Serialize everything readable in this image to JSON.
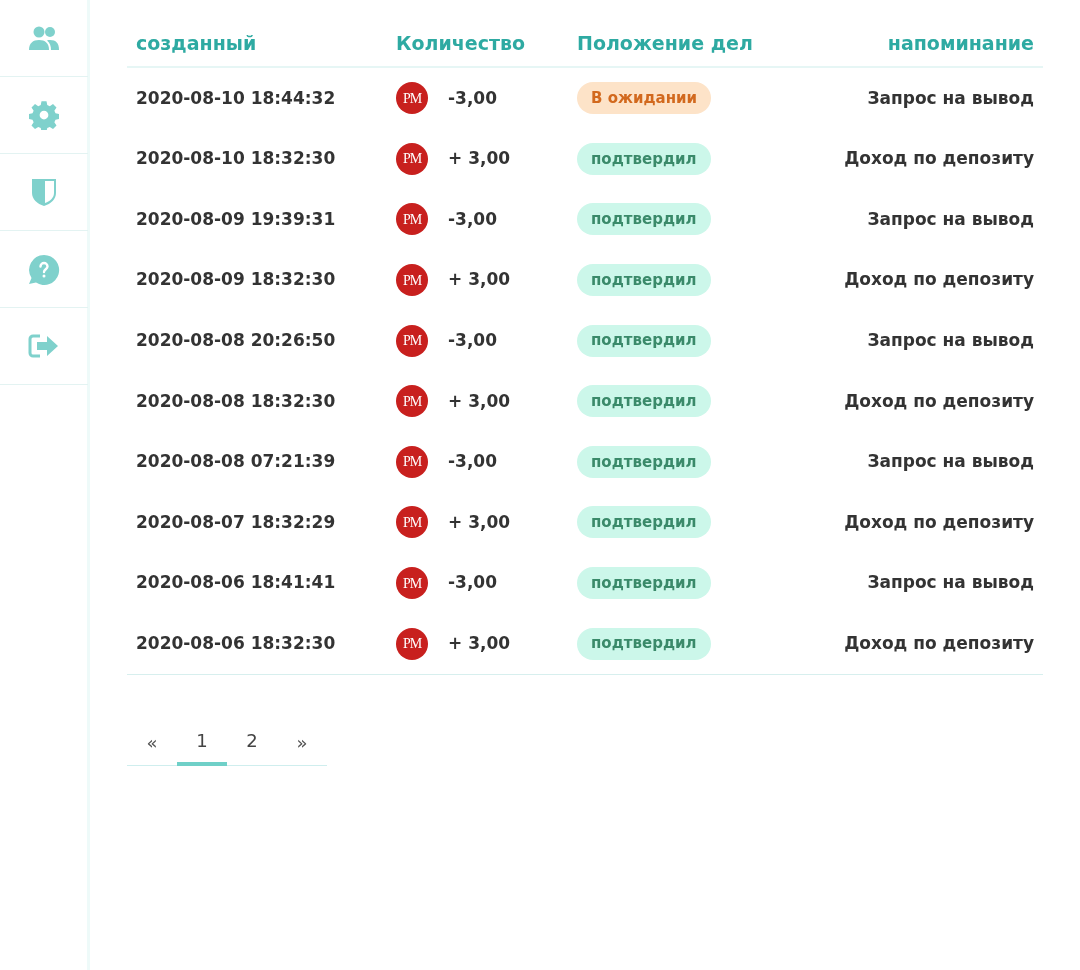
{
  "sidebar": {
    "items": [
      {
        "kind": "users"
      },
      {
        "kind": "settings"
      },
      {
        "kind": "shield"
      },
      {
        "kind": "help"
      },
      {
        "kind": "logout"
      }
    ]
  },
  "table": {
    "columns": [
      "созданный",
      "Количество",
      "Положение дел",
      "напоминание"
    ],
    "rows": [
      {
        "created": "2020-08-10 18:44:32",
        "currency": "PM",
        "amount": "-3,00",
        "status": {
          "kind": "pending",
          "label": "В ожидании"
        },
        "note": "Запрос на вывод"
      },
      {
        "created": "2020-08-10 18:32:30",
        "currency": "PM",
        "amount": "+ 3,00",
        "status": {
          "kind": "confirmed",
          "label": "подтвердил"
        },
        "note": "Доход по депозиту"
      },
      {
        "created": "2020-08-09 19:39:31",
        "currency": "PM",
        "amount": "-3,00",
        "status": {
          "kind": "confirmed",
          "label": "подтвердил"
        },
        "note": "Запрос на вывод"
      },
      {
        "created": "2020-08-09 18:32:30",
        "currency": "PM",
        "amount": "+ 3,00",
        "status": {
          "kind": "confirmed",
          "label": "подтвердил"
        },
        "note": "Доход по депозиту"
      },
      {
        "created": "2020-08-08 20:26:50",
        "currency": "PM",
        "amount": "-3,00",
        "status": {
          "kind": "confirmed",
          "label": "подтвердил"
        },
        "note": "Запрос на вывод"
      },
      {
        "created": "2020-08-08 18:32:30",
        "currency": "PM",
        "amount": "+ 3,00",
        "status": {
          "kind": "confirmed",
          "label": "подтвердил"
        },
        "note": "Доход по депозиту"
      },
      {
        "created": "2020-08-08 07:21:39",
        "currency": "PM",
        "amount": "-3,00",
        "status": {
          "kind": "confirmed",
          "label": "подтвердил"
        },
        "note": "Запрос на вывод"
      },
      {
        "created": "2020-08-07 18:32:29",
        "currency": "PM",
        "amount": "+ 3,00",
        "status": {
          "kind": "confirmed",
          "label": "подтвердил"
        },
        "note": "Доход по депозиту"
      },
      {
        "created": "2020-08-06 18:41:41",
        "currency": "PM",
        "amount": "-3,00",
        "status": {
          "kind": "confirmed",
          "label": "подтвердил"
        },
        "note": "Запрос на вывод"
      },
      {
        "created": "2020-08-06 18:32:30",
        "currency": "PM",
        "amount": "+ 3,00",
        "status": {
          "kind": "confirmed",
          "label": "подтвердил"
        },
        "note": "Доход по депозиту"
      }
    ]
  },
  "pagination": {
    "prev": "«",
    "pages": [
      {
        "label": "1",
        "selected": true
      },
      {
        "label": "2",
        "selected": false
      }
    ],
    "next": "»"
  }
}
